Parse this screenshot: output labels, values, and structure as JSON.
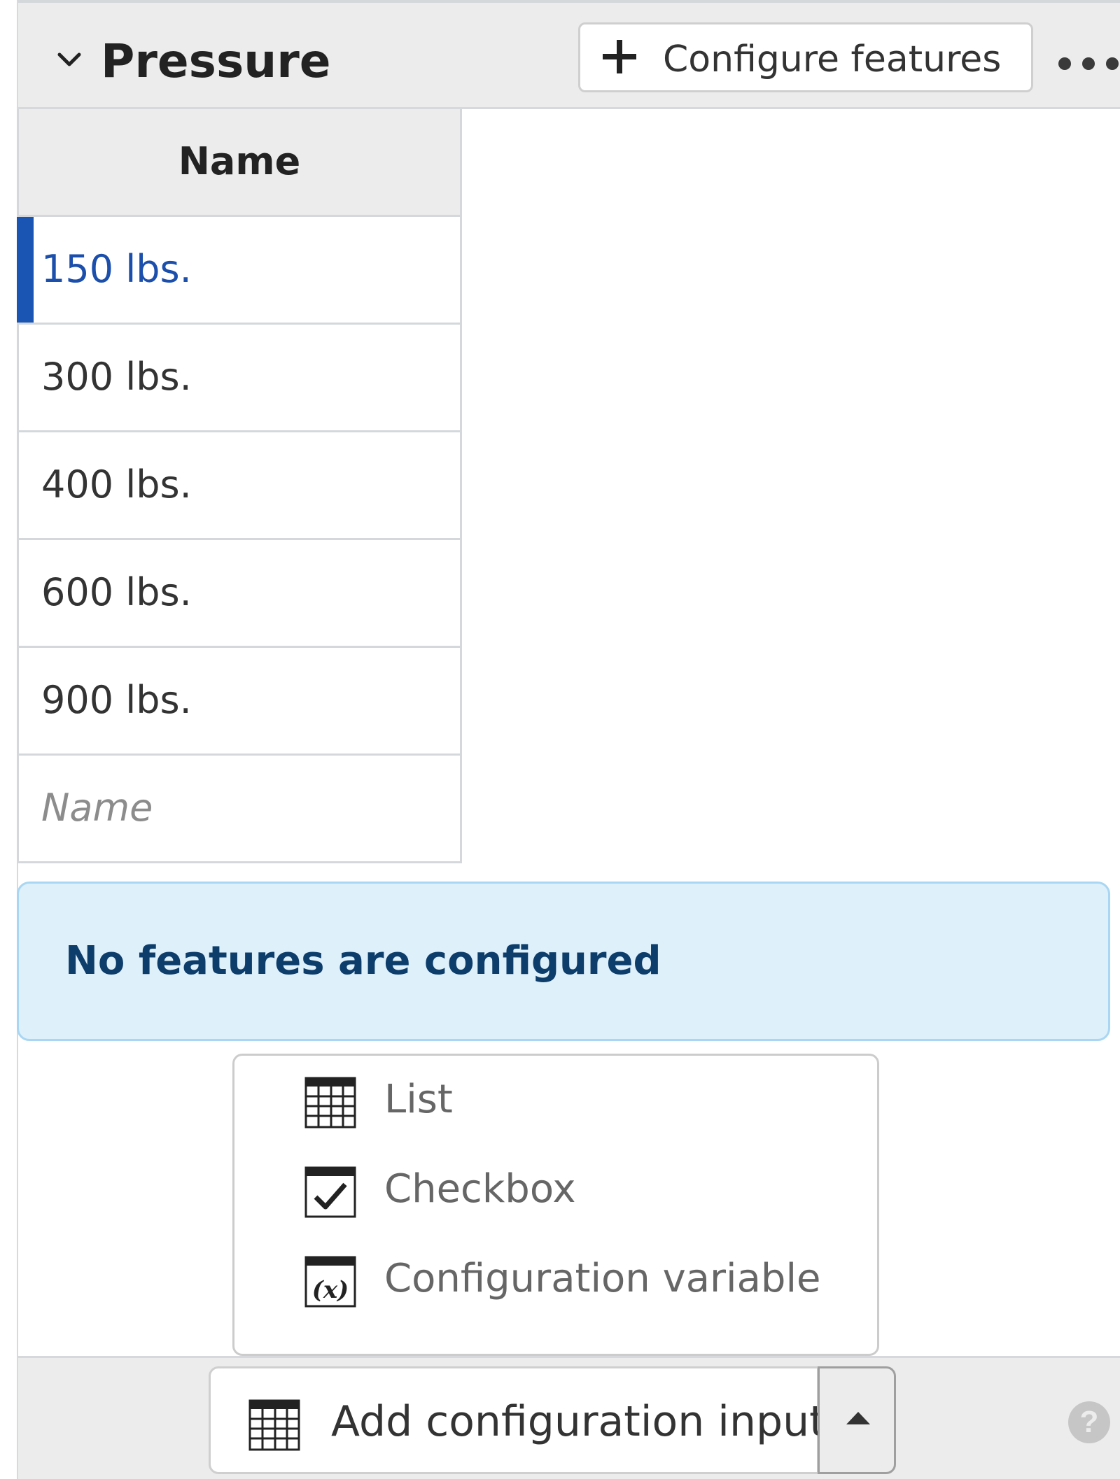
{
  "header": {
    "title": "Pressure",
    "configure_label": "Configure features",
    "expand_icon": "chevron-down-icon",
    "more_icon": "more-horizontal-icon"
  },
  "table": {
    "column_header": "Name",
    "rows": [
      "150 lbs.",
      "300 lbs.",
      "400 lbs.",
      "600 lbs.",
      "900 lbs."
    ],
    "selected_index": 0,
    "new_row_placeholder": "Name"
  },
  "info": {
    "message": "No features are configured"
  },
  "menu": {
    "items": [
      {
        "label": "List",
        "icon": "table-icon"
      },
      {
        "label": "Checkbox",
        "icon": "checkbox-icon"
      },
      {
        "label": "Configuration variable",
        "icon": "variable-icon"
      }
    ]
  },
  "footer": {
    "add_label": "Add configuration input",
    "add_icon": "table-icon",
    "help_icon": "help-icon",
    "help_glyph": "?"
  },
  "colors": {
    "accent": "#1b55b3",
    "info_bg": "#def0fa",
    "info_text": "#0d3d6b"
  }
}
